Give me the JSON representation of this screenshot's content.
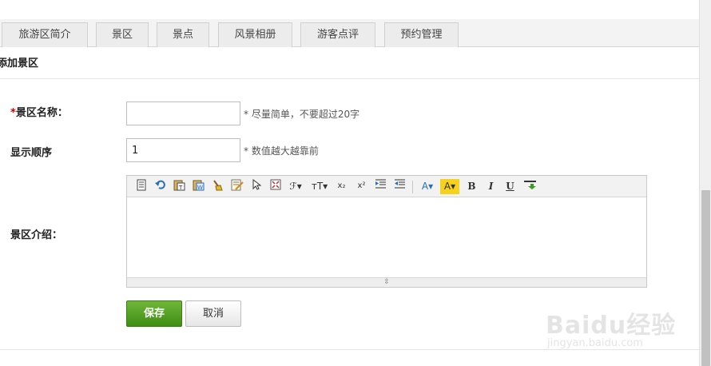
{
  "tabs": [
    {
      "label": "旅游区简介"
    },
    {
      "label": "景区"
    },
    {
      "label": "景点"
    },
    {
      "label": "风景相册"
    },
    {
      "label": "游客点评"
    },
    {
      "label": "预约管理"
    }
  ],
  "section": {
    "title": "添加景区"
  },
  "form": {
    "name": {
      "required_mark": "*",
      "label": "景区名称：",
      "value": "",
      "hint": "* 尽量简单，不要超过20字"
    },
    "order": {
      "label": "显示顺序",
      "value": "1",
      "hint": "* 数值越大越靠前"
    },
    "intro": {
      "label": "景区介绍："
    }
  },
  "editor": {
    "toolbar_icons": [
      "source-icon",
      "undo-icon",
      "paste-text-icon",
      "paste-word-icon",
      "clear-format-icon",
      "select-all-icon",
      "cursor-icon",
      "fullscreen-icon",
      "font-family-icon",
      "font-size-icon",
      "subscript-icon",
      "superscript-icon",
      "indent-icon",
      "outdent-icon",
      "font-color-icon",
      "highlight-icon",
      "bold-icon",
      "italic-icon",
      "underline-icon",
      "insert-icon"
    ],
    "glyphs": {
      "font_family": "ℱ▾",
      "font_size": "тT▾",
      "subscript": "x₂",
      "superscript": "x²",
      "font_color": "A▾",
      "highlight": "A▾",
      "bold": "B",
      "italic": "I",
      "underline": "U"
    },
    "resize_glyph": "⇳"
  },
  "buttons": {
    "save": "保存",
    "cancel": "取消"
  },
  "watermark": {
    "logo": "Baidu经验",
    "url": "jingyan.baidu.com"
  },
  "colors": {
    "save_green": "#4c9c1c",
    "required_red": "#cc0000"
  }
}
